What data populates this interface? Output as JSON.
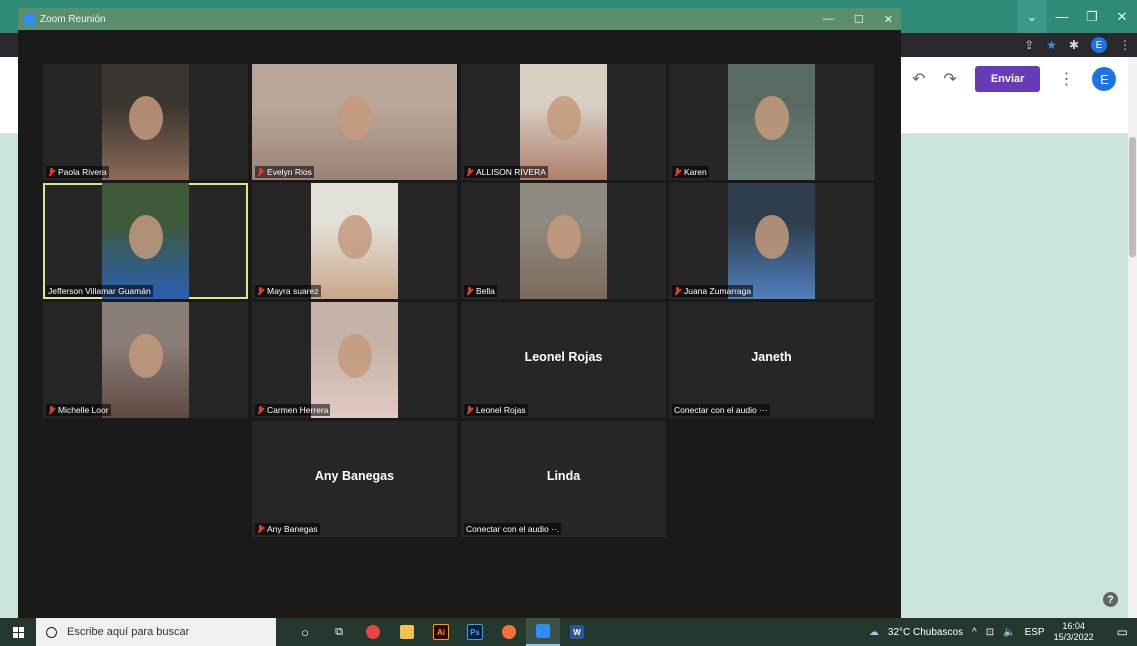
{
  "zoom": {
    "title": "Zoom Reunión",
    "participants": [
      {
        "name": "Paola Rivera",
        "label": "Paola Rivera",
        "muted": true,
        "video": true,
        "color": "#8a6a58",
        "bg": "#3a3530"
      },
      {
        "name": "Evelyn Rios",
        "label": "Evelyn Rios",
        "muted": true,
        "video": true,
        "color": "#9c8378",
        "bg": "#b9a89a"
      },
      {
        "name": "ALLISON RIVERA",
        "label": "ALLISON RIVERA",
        "muted": true,
        "video": true,
        "color": "#b07f6b",
        "bg": "#d7cfc4"
      },
      {
        "name": "Karen",
        "label": "Karen",
        "muted": true,
        "video": true,
        "color": "#6d7f7a",
        "bg": "#5a6a62"
      },
      {
        "name": "Jefferson Villamar Guamán",
        "label": "Jefferson Villamar Guamán",
        "muted": false,
        "video": true,
        "color": "#2b5fb5",
        "bg": "#3e5a3a"
      },
      {
        "name": "Mayra suarez",
        "label": "Mayra suarez",
        "muted": true,
        "video": true,
        "color": "#c9a78c",
        "bg": "#e3e0d8"
      },
      {
        "name": "Bella",
        "label": "Bella",
        "muted": true,
        "video": true,
        "color": "#7c6a5c",
        "bg": "#8f8a80"
      },
      {
        "name": "Juana Zumarraga",
        "label": "Juana Zumarraga",
        "muted": true,
        "video": true,
        "color": "#4f7fbf",
        "bg": "#2e3e4c"
      },
      {
        "name": "Michelle Loor",
        "label": "Michelle Loor",
        "muted": true,
        "video": true,
        "color": "#5e4a43",
        "bg": "#8a7f78"
      },
      {
        "name": "Carmen Herrera",
        "label": "Carmen Herrera",
        "muted": true,
        "video": true,
        "color": "#e1c9c4",
        "bg": "#c4b3a8"
      },
      {
        "name": "Leonel Rojas",
        "label": "Leonel Rojas",
        "muted": true,
        "video": false
      },
      {
        "name": "Janeth",
        "label": "Conectar con el audio ···",
        "muted": false,
        "video": false
      },
      {
        "name": "Any Banegas",
        "label": "Any Banegas",
        "muted": true,
        "video": false
      },
      {
        "name": "Linda",
        "label": "Conectar con el audio ··.",
        "muted": false,
        "video": false
      }
    ]
  },
  "forms": {
    "send_label": "Enviar",
    "avatar_letter": "E",
    "undo_icon": "undo-icon",
    "redo_icon": "redo-icon",
    "accent": "#673ab7"
  },
  "browser": {
    "profile_letter": "E"
  },
  "taskbar": {
    "search_placeholder": "Escribe aquí para buscar",
    "weather": "32°C  Chubascos",
    "language": "ESP",
    "time": "16:04",
    "date": "15/3/2022"
  }
}
